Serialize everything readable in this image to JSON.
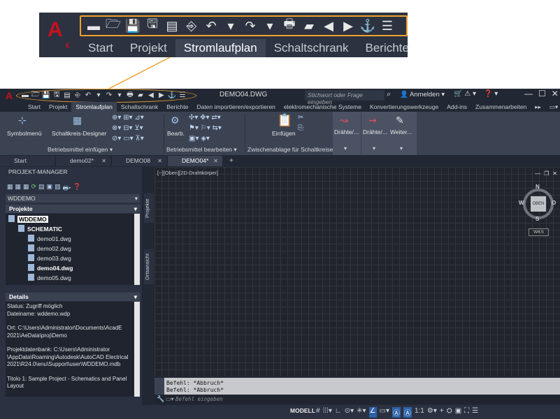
{
  "zoom": {
    "logo": "A",
    "logo_sub": "E",
    "qat_icons": [
      "new-icon",
      "open-icon",
      "save-icon",
      "save-as-icon",
      "project-open-icon",
      "export-icon",
      "undo-icon",
      "undo-dropdown-icon",
      "redo-icon",
      "redo-dropdown-icon",
      "print-icon",
      "folder-icon",
      "back-icon",
      "forward-icon",
      "wire-icon",
      "customize-dropdown-icon"
    ],
    "qat_glyphs": [
      "▬",
      "🗁",
      "💾",
      "🖫",
      "▤",
      "⎆",
      "↶",
      "▾",
      "↷",
      "▾",
      "🖶",
      "▰",
      "◀",
      "▶",
      "⚓",
      "☰"
    ],
    "tabs": [
      "Start",
      "Projekt",
      "Stromlaufplan",
      "Schaltschrank",
      "Berichte"
    ],
    "active_tab": 2
  },
  "app": {
    "logo": "A",
    "document_title": "DEMO04.DWG",
    "search_placeholder": "Stichwort oder Frage eingeben",
    "signin_label": "Anmelden",
    "window_controls": [
      "—",
      "☐",
      "✕"
    ]
  },
  "menu_tabs": [
    "Start",
    "Projekt",
    "Stromlaufplan",
    "Schaltschrank",
    "Berichte",
    "Daten importieren/exportieren",
    "elektromechanische Systeme",
    "Konvertierungswerkzeuge",
    "Add-ins",
    "Zusammenarbeiten",
    "▸▸",
    "▭▾"
  ],
  "menu_active": 2,
  "ribbon": {
    "symbolmenu": "Symbolmenü",
    "schaltkreis": "Schaltkreis-Designer",
    "group1": "Betriebsmittel einfügen ▾",
    "bearb": "Bearb.",
    "group2": "Betriebsmittel bearbeiten ▾",
    "einfuegen": "Einfügen",
    "group3": "Zwischenablage für Schaltkreise",
    "draehte1": "Drähte/...",
    "draehte2": "Drähte/...",
    "weiter": "Weiter..."
  },
  "doc_tabs": [
    {
      "label": "Start",
      "close": ""
    },
    {
      "label": "demo02*",
      "close": "✕"
    },
    {
      "label": "DEMO08",
      "close": "✕"
    },
    {
      "label": "DEMO04*",
      "close": "✕"
    }
  ],
  "doc_tab_add": "+",
  "project_manager": {
    "title": "PROJEKT-MANAGER",
    "dropdown_value": "WDDEMO",
    "projects_header": "Projekte",
    "tree": [
      {
        "label": "WDDEMO",
        "level": 0,
        "bold": true
      },
      {
        "label": "SCHEMATIC",
        "level": 1,
        "bold": true
      },
      {
        "label": "demo01.dwg",
        "level": 2,
        "bold": false
      },
      {
        "label": "demo02.dwg",
        "level": 2,
        "bold": false
      },
      {
        "label": "demo03.dwg",
        "level": 2,
        "bold": false
      },
      {
        "label": "demo04.dwg",
        "level": 2,
        "bold": true
      },
      {
        "label": "demo05.dwg",
        "level": 2,
        "bold": false
      }
    ],
    "details_header": "Details",
    "details": [
      "Status: Zugriff möglich",
      "Dateiname: wddemo.wdp",
      "",
      "Ort: C:\\Users\\Administrator\\Documents\\AcadE 2021\\AeData\\proj\\Demo",
      "",
      "Projektdatenbank: C:\\Users\\Administrator \\AppData\\Roaming\\Autodesk\\AutoCAD Electrical 2021\\R24.0\\enu\\Support\\user\\WDDEMO.mdb",
      "",
      "Titolo 1: Sample Project - Schematics and Panel Layout"
    ],
    "side_tabs": [
      "Projekte",
      "Ortsansicht"
    ]
  },
  "viewport": {
    "label": "[−][Oben][2D-Drahtkörper]",
    "compass": {
      "n": "N",
      "s": "S",
      "w": "W",
      "e": "O",
      "center": "OBEN"
    },
    "wks": "WKS"
  },
  "command": {
    "history": [
      "Befehl: *Abbruch*",
      "Befehl: *Abbruch*"
    ],
    "placeholder": "Befehl eingeben"
  },
  "statusbar": {
    "model": "MODELL",
    "scale": "1:1"
  }
}
